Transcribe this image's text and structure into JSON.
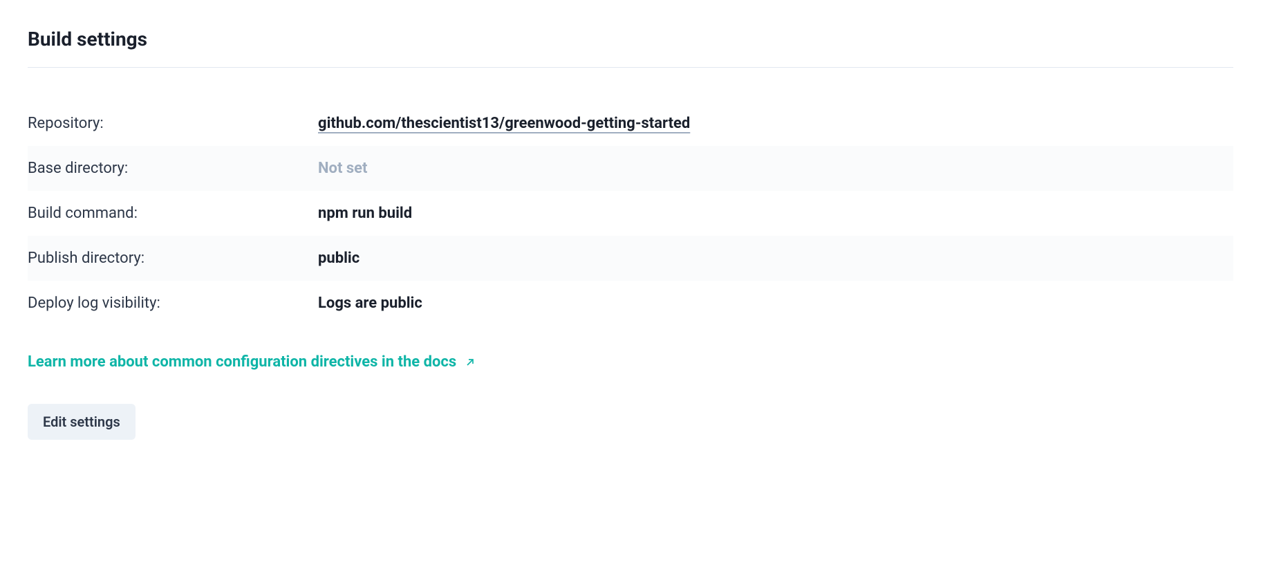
{
  "section": {
    "title": "Build settings"
  },
  "settings": {
    "repository": {
      "label": "Repository:",
      "value": "github.com/thescientist13/greenwood-getting-started"
    },
    "base_directory": {
      "label": "Base directory:",
      "value": "Not set"
    },
    "build_command": {
      "label": "Build command:",
      "value": "npm run build"
    },
    "publish_directory": {
      "label": "Publish directory:",
      "value": "public"
    },
    "deploy_log_visibility": {
      "label": "Deploy log visibility:",
      "value": "Logs are public"
    }
  },
  "learn_more": {
    "text": "Learn more about common configuration directives in the docs"
  },
  "actions": {
    "edit_label": "Edit settings"
  }
}
